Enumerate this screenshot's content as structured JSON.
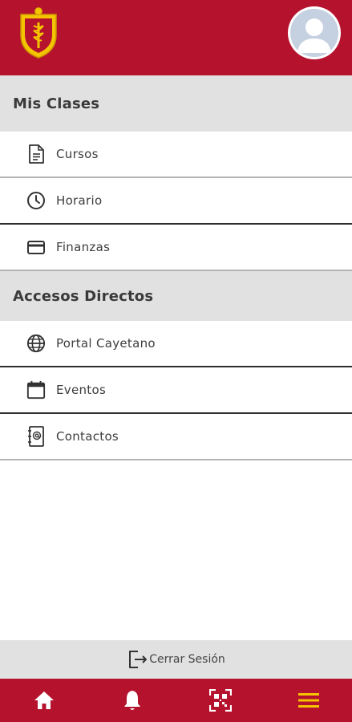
{
  "colors": {
    "brand": "#b5122e",
    "section_bg": "#e1e1e1",
    "accent": "#f4c400"
  },
  "header": {
    "logo_icon": "university-crest-icon",
    "avatar_icon": "user-avatar-icon"
  },
  "sections": [
    {
      "title": "Mis Clases",
      "items": [
        {
          "label": "Cursos",
          "icon": "document-icon"
        },
        {
          "label": "Horario",
          "icon": "clock-icon"
        },
        {
          "label": "Finanzas",
          "icon": "credit-card-icon"
        }
      ]
    },
    {
      "title": "Accesos Directos",
      "items": [
        {
          "label": "Portal Cayetano",
          "icon": "globe-icon"
        },
        {
          "label": "Eventos",
          "icon": "calendar-icon"
        },
        {
          "label": "Contactos",
          "icon": "contacts-book-icon"
        }
      ]
    }
  ],
  "logout": {
    "label": "Cerrar Sesión",
    "icon": "logout-icon"
  },
  "bottom_nav": [
    {
      "icon": "home-icon"
    },
    {
      "icon": "bell-icon"
    },
    {
      "icon": "qr-code-icon"
    },
    {
      "icon": "hamburger-menu-icon"
    }
  ]
}
